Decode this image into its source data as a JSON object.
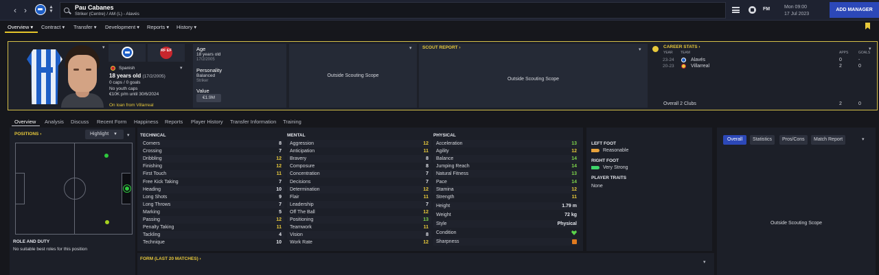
{
  "topbar": {
    "player_name": "Pau Cabanes",
    "player_positions": "Striker (Centre) / AM (L) - Alavés",
    "date_day": "Mon 09:00",
    "date": "17 Jul 2023",
    "add_manager": "ADD MANAGER",
    "fm_label": "FM"
  },
  "subnav": [
    "Overview",
    "Contract",
    "Transfer",
    "Development",
    "Reports",
    "History"
  ],
  "profile": {
    "nationality": "Spanish",
    "age_line": "18 years old",
    "dob_paren": "(17/2/2005)",
    "caps": "0 caps / 0 goals",
    "youth_caps": "No youth caps",
    "wage": "€10K p/m until 30/6/2024",
    "loan": "On loan from Villarreal",
    "rfef": "RF EF"
  },
  "info": {
    "age_label": "Age",
    "age_value": "18 years old",
    "dob": "17/2/2005",
    "personality_label": "Personality",
    "personality": "Balanced",
    "role": "Striker",
    "value_label": "Value",
    "value": "€1.9M"
  },
  "scouting": {
    "outside_1": "Outside Scouting Scope",
    "scout_report": "SCOUT REPORT",
    "outside_2": "Outside Scouting Scope",
    "outside_3": "Outside Scouting Scope"
  },
  "career": {
    "title": "CAREER STATS",
    "h_year": "YEAR",
    "h_team": "TEAM",
    "h_apps": "APPS",
    "h_goals": "GOALS",
    "rows": [
      {
        "year": "23-24",
        "team": "Alavés",
        "apps": "0",
        "goals": "-"
      },
      {
        "year": "20-23",
        "team": "Villarreal",
        "apps": "2",
        "goals": "0"
      }
    ],
    "overall_label": "Overall 2 Clubs",
    "overall_apps": "2",
    "overall_goals": "0"
  },
  "tabs": [
    "Overview",
    "Analysis",
    "Discuss",
    "Recent Form",
    "Happiness",
    "Reports",
    "Player History",
    "Transfer Information",
    "Training"
  ],
  "positions": {
    "title": "POSITIONS",
    "highlight": "Highlight",
    "role_title": "ROLE AND DUTY",
    "role_text": "No suitable best roles for this position"
  },
  "technical": {
    "title": "TECHNICAL",
    "rows": [
      {
        "name": "Corners",
        "value": "8"
      },
      {
        "name": "Crossing",
        "value": "7"
      },
      {
        "name": "Dribbling",
        "value": "12"
      },
      {
        "name": "Finishing",
        "value": "12"
      },
      {
        "name": "First Touch",
        "value": "11"
      },
      {
        "name": "Free Kick Taking",
        "value": "7"
      },
      {
        "name": "Heading",
        "value": "10"
      },
      {
        "name": "Long Shots",
        "value": "9"
      },
      {
        "name": "Long Throws",
        "value": "7"
      },
      {
        "name": "Marking",
        "value": "5"
      },
      {
        "name": "Passing",
        "value": "12"
      },
      {
        "name": "Penalty Taking",
        "value": "11"
      },
      {
        "name": "Tackling",
        "value": "4"
      },
      {
        "name": "Technique",
        "value": "10"
      }
    ]
  },
  "mental": {
    "title": "MENTAL",
    "rows": [
      {
        "name": "Aggression",
        "value": "12"
      },
      {
        "name": "Anticipation",
        "value": "11"
      },
      {
        "name": "Bravery",
        "value": "8"
      },
      {
        "name": "Composure",
        "value": "8"
      },
      {
        "name": "Concentration",
        "value": "7"
      },
      {
        "name": "Decisions",
        "value": "7"
      },
      {
        "name": "Determination",
        "value": "12"
      },
      {
        "name": "Flair",
        "value": "11"
      },
      {
        "name": "Leadership",
        "value": "7"
      },
      {
        "name": "Off The Ball",
        "value": "12"
      },
      {
        "name": "Positioning",
        "value": "13"
      },
      {
        "name": "Teamwork",
        "value": "11"
      },
      {
        "name": "Vision",
        "value": "8"
      },
      {
        "name": "Work Rate",
        "value": "12"
      }
    ]
  },
  "physical": {
    "title": "PHYSICAL",
    "rows": [
      {
        "name": "Acceleration",
        "value": "13"
      },
      {
        "name": "Agility",
        "value": "12"
      },
      {
        "name": "Balance",
        "value": "14"
      },
      {
        "name": "Jumping Reach",
        "value": "14"
      },
      {
        "name": "Natural Fitness",
        "value": "13"
      },
      {
        "name": "Pace",
        "value": "14"
      },
      {
        "name": "Stamina",
        "value": "12"
      },
      {
        "name": "Strength",
        "value": "11"
      }
    ],
    "height_label": "Height",
    "height": "1.79 m",
    "weight_label": "Weight",
    "weight": "72 kg",
    "style_label": "Style",
    "style": "Physical",
    "condition_label": "Condition",
    "sharpness_label": "Sharpness"
  },
  "form": {
    "title": "FORM (LAST 20 MATCHES)"
  },
  "feet": {
    "left_title": "LEFT FOOT",
    "left": "Reasonable",
    "right_title": "RIGHT FOOT",
    "right": "Very Strong",
    "traits_title": "PLAYER TRAITS",
    "traits": "None"
  },
  "right_tabs": [
    "Overall",
    "Statistics",
    "Pros/Cons",
    "Match Report"
  ],
  "colors": {
    "accent": "#e8c93b",
    "good": "#7ed54b",
    "button": "#2c48b8",
    "brand_blue": "#1f5fc6"
  }
}
